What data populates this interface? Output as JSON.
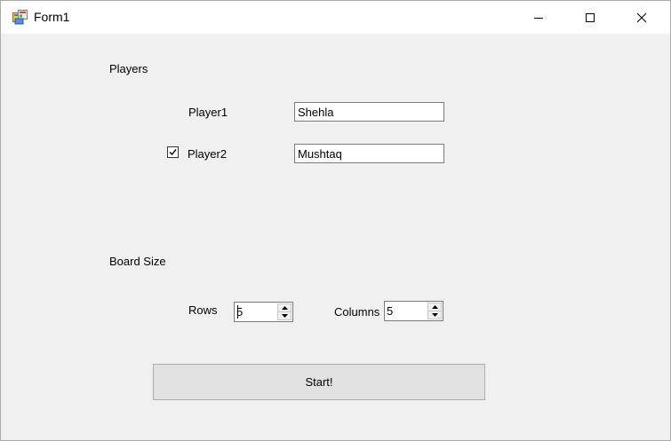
{
  "window": {
    "title": "Form1",
    "icon": "winforms-app-icon"
  },
  "players": {
    "group_label": "Players",
    "player1": {
      "label": "Player1",
      "name_value": "Shehla"
    },
    "player2": {
      "label": "Player2",
      "checked": true,
      "name_value": "Mushtaq"
    }
  },
  "board_size": {
    "group_label": "Board Size",
    "rows": {
      "label": "Rows",
      "value": "5"
    },
    "columns": {
      "label": "Columns",
      "value": "5"
    }
  },
  "start_button": {
    "label": "Start!"
  },
  "colors": {
    "window_bg": "#f0f0f0",
    "titlebar_bg": "#ffffff",
    "button_bg": "#e1e1e1",
    "border": "#7a7a7a"
  }
}
